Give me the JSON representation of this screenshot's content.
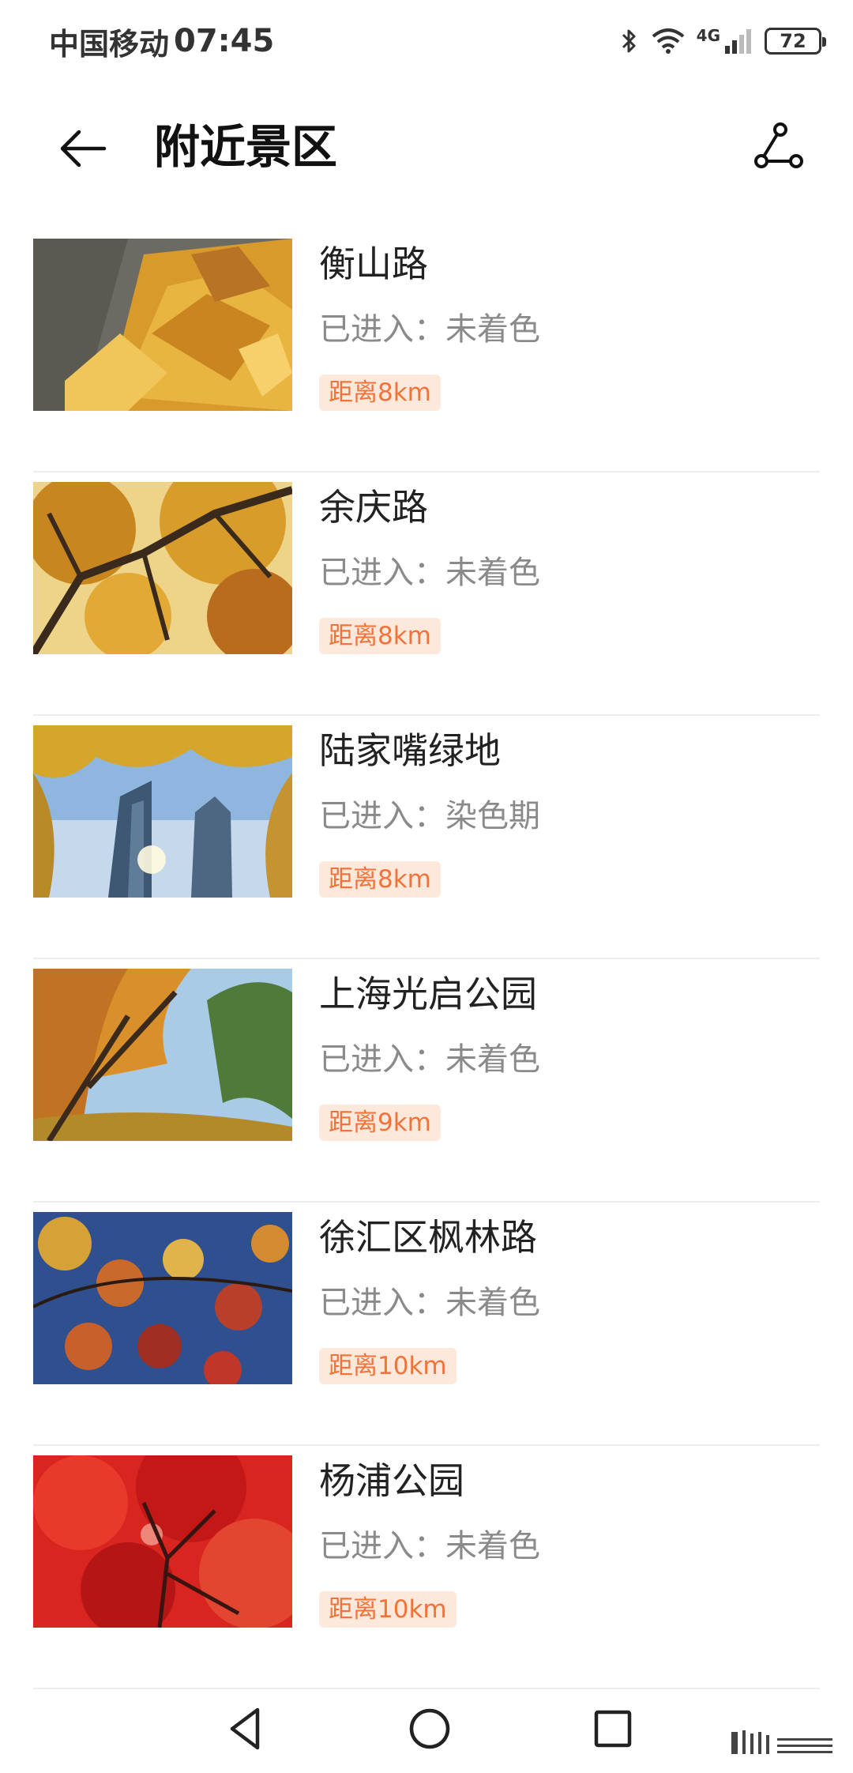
{
  "status_bar": {
    "carrier": "中国移动",
    "time": "07:45",
    "network": "4G",
    "battery": "72"
  },
  "header": {
    "title": "附近景区",
    "back_icon": "arrow-left-icon",
    "route_icon": "route-icon"
  },
  "spots": [
    {
      "name": "衡山路",
      "status": "已进入：未着色",
      "distance": "距离8km",
      "thumb_icon": "fallen-leaves-photo"
    },
    {
      "name": "余庆路",
      "status": "已进入：未着色",
      "distance": "距离8km",
      "thumb_icon": "autumn-tree-photo"
    },
    {
      "name": "陆家嘴绿地",
      "status": "已进入：染色期",
      "distance": "距离8km",
      "thumb_icon": "skyline-ginkgo-photo"
    },
    {
      "name": "上海光启公园",
      "status": "已进入：未着色",
      "distance": "距离9km",
      "thumb_icon": "park-trees-photo"
    },
    {
      "name": "徐汇区枫林路",
      "status": "已进入：未着色",
      "distance": "距离10km",
      "thumb_icon": "maple-leaves-photo"
    },
    {
      "name": "杨浦公园",
      "status": "已进入：未着色",
      "distance": "距离10km",
      "thumb_icon": "red-maple-photo"
    }
  ],
  "colors": {
    "distance_text": "#f0743a",
    "distance_bg": "#fde8dc",
    "divider": "#ececec"
  },
  "nav_bar": {
    "back_icon": "triangle-back-icon",
    "home_icon": "circle-home-icon",
    "recent_icon": "square-recent-icon"
  }
}
